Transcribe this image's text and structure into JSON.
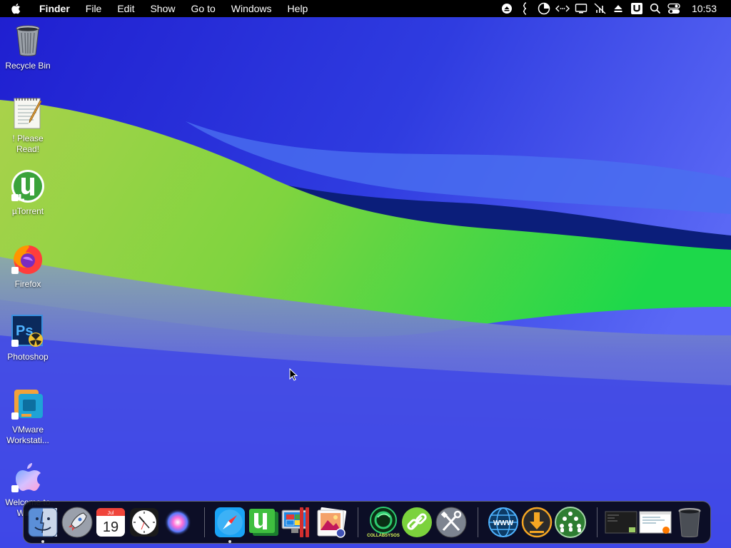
{
  "menubar": {
    "app_name": "Finder",
    "items": [
      "File",
      "Edit",
      "Show",
      "Go to",
      "Windows",
      "Help"
    ],
    "status_icons": [
      "eject-icon",
      "script-icon",
      "timer-icon",
      "code-arrows-icon",
      "display-icon",
      "wifi-off-icon",
      "eject-up-icon",
      "u-badge-icon",
      "search-icon",
      "control-center-icon"
    ],
    "clock": "10:53"
  },
  "desktop": {
    "icons": [
      {
        "label": "Recycle Bin",
        "icon": "recycle-bin-icon"
      },
      {
        "label": "! Please Read!",
        "icon": "text-document-icon"
      },
      {
        "label": "µTorrent",
        "icon": "utorrent-icon"
      },
      {
        "label": "Firefox",
        "icon": "firefox-icon"
      },
      {
        "label": "Photoshop",
        "icon": "photoshop-icon"
      },
      {
        "label": "VMware Workstati...",
        "icon": "vmware-icon"
      },
      {
        "label": "Welcome to Win...",
        "icon": "apple-logo-icon"
      }
    ]
  },
  "dock": {
    "items": [
      {
        "name": "finder",
        "icon": "finder-icon",
        "running": true
      },
      {
        "name": "launchpad",
        "icon": "rocket-icon",
        "running": false
      },
      {
        "name": "calendar",
        "icon": "calendar-icon",
        "month": "Jul",
        "day": "19",
        "running": false
      },
      {
        "name": "clock",
        "icon": "clock-icon",
        "running": false
      },
      {
        "name": "siri",
        "icon": "siri-icon",
        "running": false
      },
      {
        "name": "safari",
        "icon": "safari-icon",
        "running": true
      },
      {
        "name": "utorrent",
        "icon": "utorrent-icon",
        "running": false
      },
      {
        "name": "parallels",
        "icon": "parallels-icon",
        "running": false
      },
      {
        "name": "preview",
        "icon": "photo-viewer-icon",
        "running": false
      },
      {
        "name": "collabsysos",
        "icon": "collabsysos-icon",
        "label": "COLLABSYSOS",
        "running": false
      },
      {
        "name": "link",
        "icon": "link-icon",
        "running": false
      },
      {
        "name": "utilities",
        "icon": "tools-icon",
        "running": false
      },
      {
        "name": "web",
        "icon": "www-globe-icon",
        "label": "WWW",
        "running": false
      },
      {
        "name": "downloader",
        "icon": "download-icon",
        "running": false
      },
      {
        "name": "network",
        "icon": "people-network-icon",
        "running": false
      },
      {
        "name": "window-thumb-1",
        "icon": "window-thumbnail-icon",
        "running": false
      },
      {
        "name": "window-thumb-2",
        "icon": "window-thumbnail-icon",
        "running": false
      },
      {
        "name": "trash",
        "icon": "trash-icon",
        "running": false
      }
    ]
  },
  "colors": {
    "sky": "#3a3fe0",
    "hill": "#7fd43f",
    "menubar": "#000000"
  }
}
